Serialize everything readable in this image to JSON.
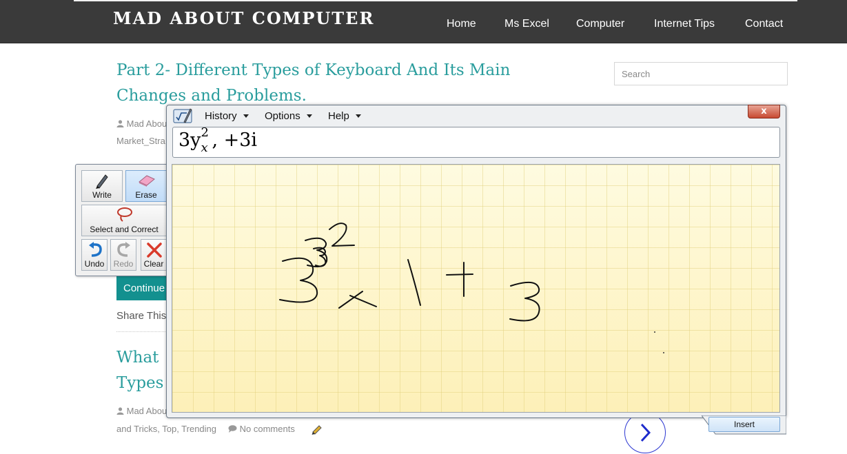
{
  "site": {
    "brand": "MAD ABOUT COMPUTER",
    "nav": [
      "Home",
      "Ms Excel",
      "Computer",
      "Internet Tips",
      "Contact"
    ],
    "search_placeholder": "Search"
  },
  "posts": {
    "first_title_line1": "Part 2- Different Types of Keyboard And Its Main",
    "first_title_line2": "Changes and Problems.",
    "first_meta_author": "Mad Abou",
    "first_meta_category": "Market_Stra",
    "continue_label": "Continue",
    "share_label": "Share This",
    "second_title_line1": "What",
    "second_title_line2": "Types",
    "second_meta_author": "Mad Abou",
    "second_meta_tags": "and Tricks, Top, Trending",
    "second_meta_comments": "No comments"
  },
  "palette": {
    "write": "Write",
    "erase": "Erase",
    "select_correct": "Select and Correct",
    "undo": "Undo",
    "redo": "Redo",
    "clear": "Clear"
  },
  "math_panel": {
    "menu": [
      "History",
      "Options",
      "Help"
    ],
    "close_glyph": "x",
    "preview_base": "3y",
    "preview_sub": "x",
    "preview_sup": "2",
    "preview_rest": ", +3i",
    "insert_label": "Insert"
  },
  "colors": {
    "header_bg": "#3a3a3a",
    "accent_teal": "#2a9d9d",
    "button_teal": "#13908f",
    "pad_yellow": "#fdf3c2"
  }
}
